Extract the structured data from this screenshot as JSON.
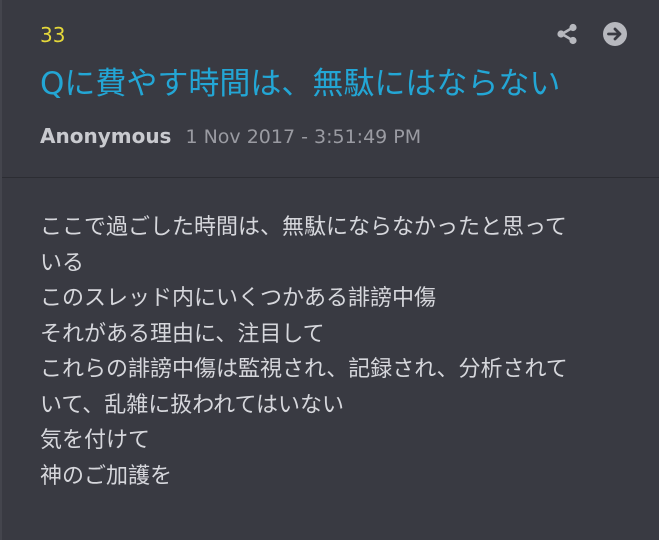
{
  "post": {
    "number": "33",
    "title": "Qに費やす時間は、無駄にはならない",
    "author": "Anonymous",
    "timestamp": "1 Nov 2017 - 3:51:49 PM",
    "lines": [
      "ここで過ごした時間は、無駄にならなかったと思って",
      "いる",
      "このスレッド内にいくつかある誹謗中傷",
      "それがある理由に、注目して",
      "これらの誹謗中傷は監視され、記録され、分析されて",
      "いて、乱雑に扱われてはいない",
      "気を付けて",
      "神のご加護を"
    ]
  },
  "actions": {
    "share_icon": "share-icon",
    "next_icon": "arrow-right-circle-icon"
  },
  "colors": {
    "background": "#393a42",
    "title": "#23a6d5",
    "post_number": "#e5d83a",
    "author": "#c9cacf",
    "timestamp": "#9a9ba2",
    "body_text": "#d6d7dc",
    "icon": "#b7b8be"
  }
}
